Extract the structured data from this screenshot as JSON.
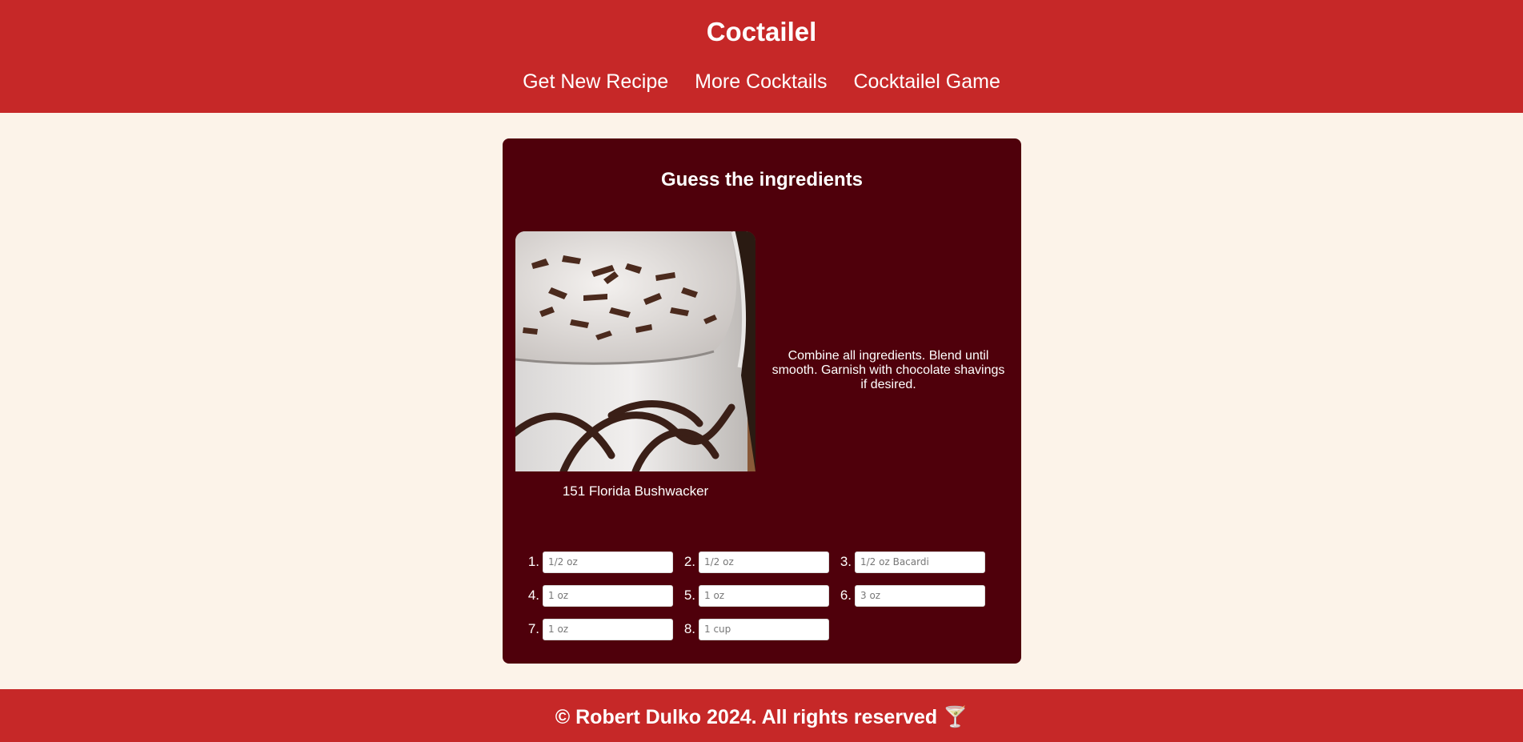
{
  "header": {
    "title": "Coctailel",
    "nav": [
      "Get New Recipe",
      "More Cocktails",
      "Cocktailel Game"
    ]
  },
  "game": {
    "title": "Guess the ingredients",
    "drink_name": "151 Florida Bushwacker",
    "instructions": "Combine all ingredients. Blend until smooth. Garnish with chocolate shavings if desired.",
    "ingredients": [
      {
        "number": "1.",
        "placeholder": "1/2 oz"
      },
      {
        "number": "2.",
        "placeholder": "1/2 oz"
      },
      {
        "number": "3.",
        "placeholder": "1/2 oz Bacardi"
      },
      {
        "number": "4.",
        "placeholder": "1 oz"
      },
      {
        "number": "5.",
        "placeholder": "1 oz"
      },
      {
        "number": "6.",
        "placeholder": "3 oz"
      },
      {
        "number": "7.",
        "placeholder": "1 oz"
      },
      {
        "number": "8.",
        "placeholder": "1 cup"
      }
    ]
  },
  "footer": {
    "copyright": "© Robert Dulko 2024. All rights reserved 🍸"
  },
  "colors": {
    "header_bg": "#c62828",
    "page_bg": "#fcf3e9",
    "card_bg": "#4f000b"
  }
}
